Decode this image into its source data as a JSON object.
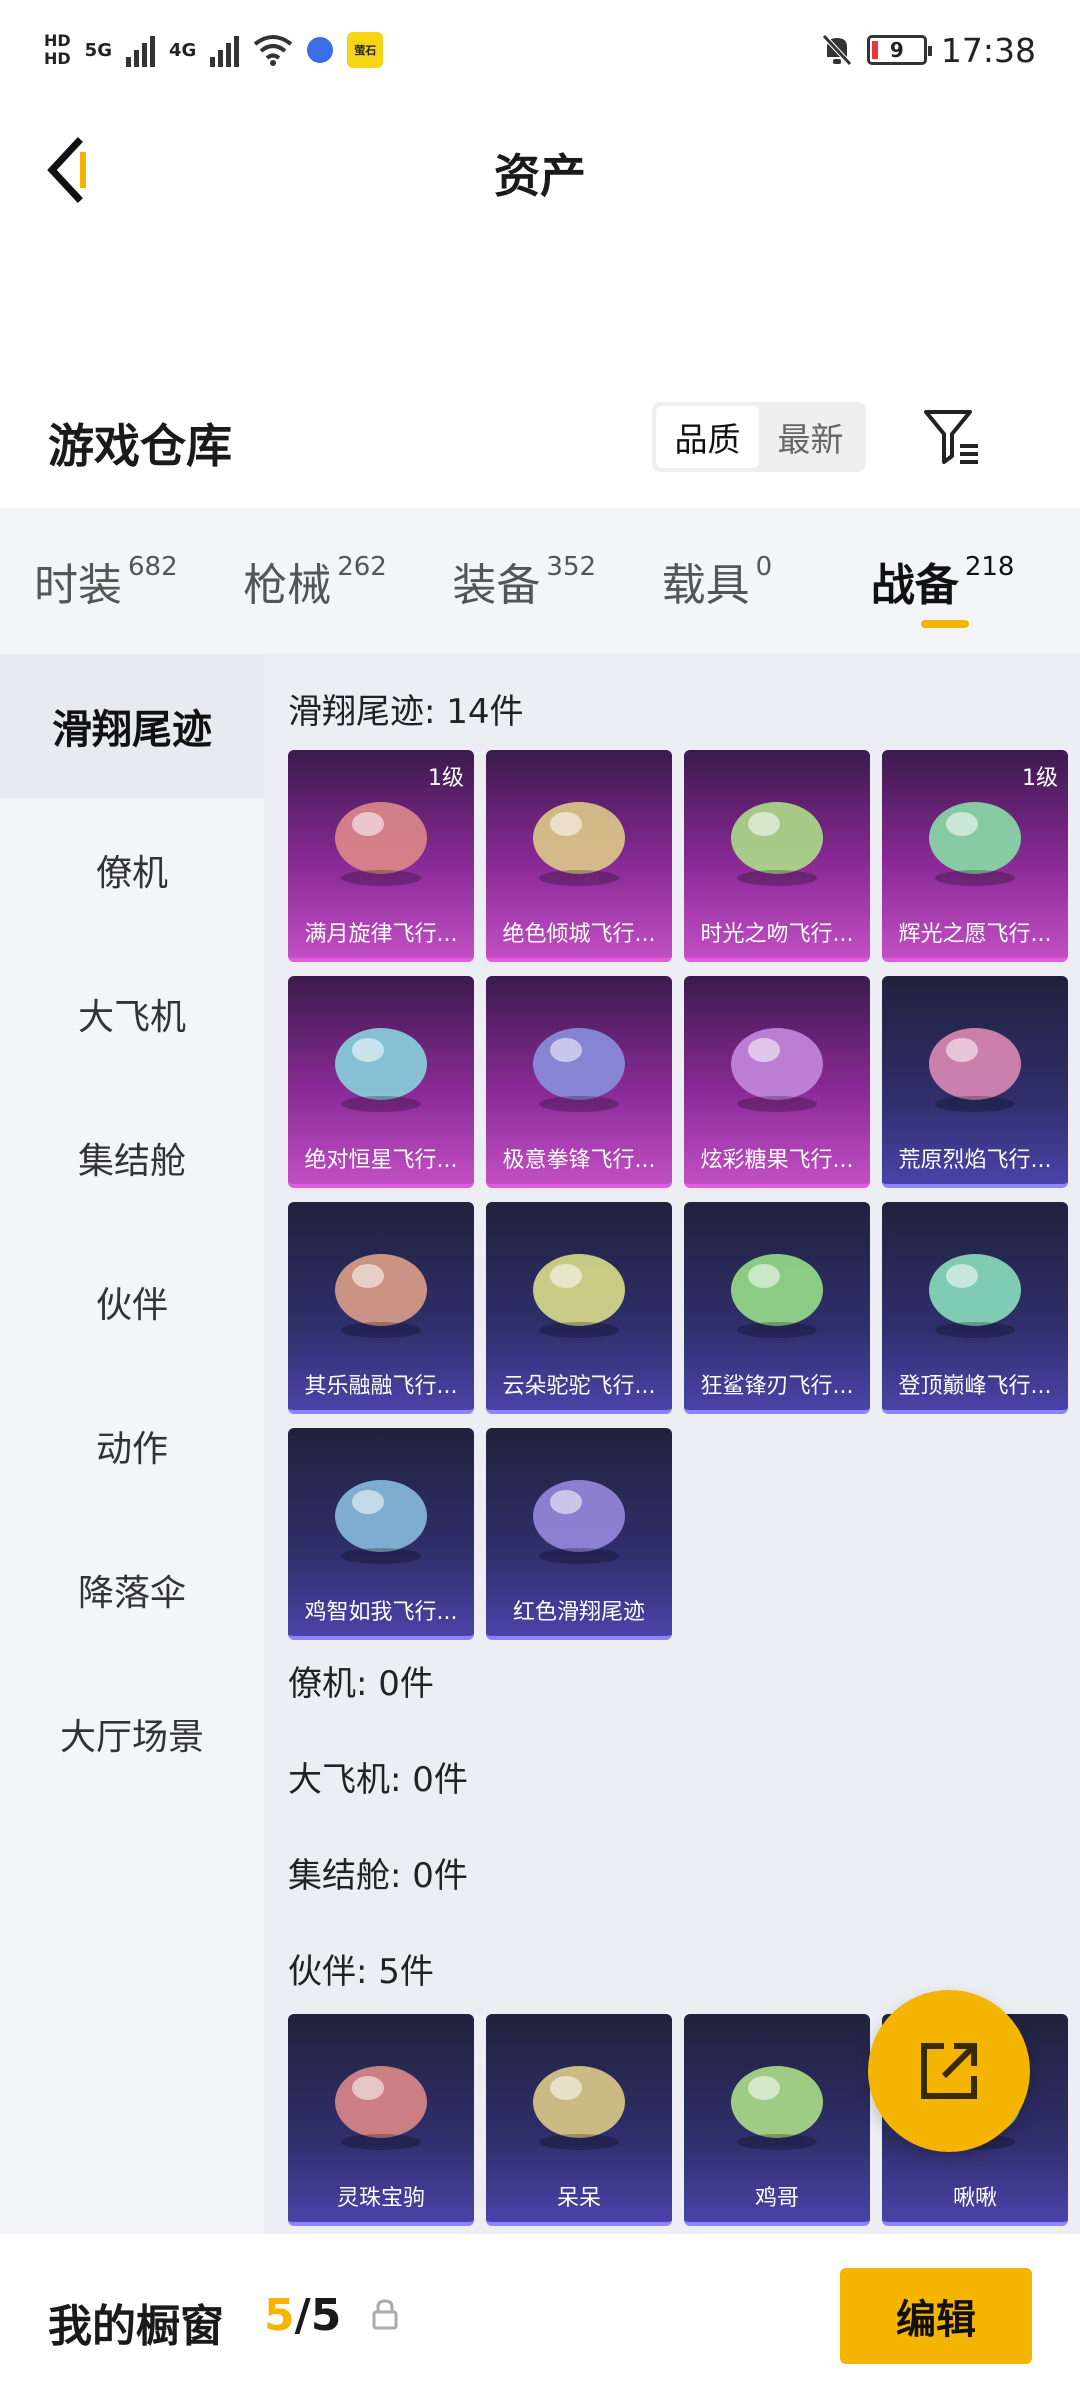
{
  "status_bar": {
    "time": "17:38",
    "battery": "9",
    "net_label_1": "5G",
    "net_label_2": "4G",
    "hd_labels": [
      "HD",
      "HD"
    ],
    "app_chip": "萤石"
  },
  "header": {
    "title": "资产",
    "back_icon": "chevron-left-icon"
  },
  "warehouse": {
    "title": "游戏仓库",
    "sort_options": [
      "品质",
      "最新"
    ],
    "sort_selected": "品质",
    "filter_icon": "filter-icon"
  },
  "tabs": [
    {
      "label": "时装",
      "count": "682"
    },
    {
      "label": "枪械",
      "count": "262"
    },
    {
      "label": "装备",
      "count": "352"
    },
    {
      "label": "载具",
      "count": "0"
    },
    {
      "label": "战备",
      "count": "218",
      "active": true
    }
  ],
  "side_menu": [
    {
      "label": "滑翔尾迹",
      "active": true
    },
    {
      "label": "僚机"
    },
    {
      "label": "大飞机"
    },
    {
      "label": "集结舱"
    },
    {
      "label": "伙伴"
    },
    {
      "label": "动作"
    },
    {
      "label": "降落伞"
    },
    {
      "label": "大厅场景"
    }
  ],
  "sections": {
    "glide": {
      "title": "滑翔尾迹: 14件",
      "items": [
        {
          "name": "满月旋律飞行...",
          "level": "1级",
          "rarity": "purple"
        },
        {
          "name": "绝色倾城飞行...",
          "rarity": "purple"
        },
        {
          "name": "时光之吻飞行...",
          "rarity": "purple"
        },
        {
          "name": "辉光之愿飞行...",
          "level": "1级",
          "rarity": "purple"
        },
        {
          "name": "绝对恒星飞行...",
          "rarity": "purple"
        },
        {
          "name": "极意拳锋飞行...",
          "rarity": "purple"
        },
        {
          "name": "炫彩糖果飞行...",
          "rarity": "purple"
        },
        {
          "name": "荒原烈焰飞行...",
          "rarity": "blue"
        },
        {
          "name": "其乐融融飞行...",
          "rarity": "blue"
        },
        {
          "name": "云朵驼驼飞行...",
          "rarity": "blue"
        },
        {
          "name": "狂鲨锋刃飞行...",
          "rarity": "blue"
        },
        {
          "name": "登顶巅峰飞行...",
          "rarity": "blue"
        },
        {
          "name": "鸡智如我飞行...",
          "rarity": "blue"
        },
        {
          "name": "红色滑翔尾迹",
          "rarity": "blue"
        }
      ]
    },
    "wingman": {
      "title": "僚机: 0件"
    },
    "big_plane": {
      "title": "大飞机: 0件"
    },
    "capsule": {
      "title": "集结舱: 0件"
    },
    "partner": {
      "title": "伙伴: 5件",
      "items": [
        {
          "name": "灵珠宝驹",
          "rarity": "blue"
        },
        {
          "name": "呆呆",
          "rarity": "blue"
        },
        {
          "name": "鸡哥",
          "rarity": "blue"
        },
        {
          "name": "啾啾",
          "rarity": "blue"
        }
      ]
    }
  },
  "fab": {
    "icon": "share-icon"
  },
  "showcase": {
    "label": "我的橱窗",
    "current": "5",
    "separator": "/",
    "total": "5",
    "lock_icon": "lock-icon",
    "edit_label": "编辑"
  },
  "colors": {
    "accent": "#f5b400",
    "purple_card": "#8a2a96",
    "blue_card": "#2f2f6c",
    "side_bg": "#f4f5f8",
    "content_bg": "#eceef3"
  }
}
